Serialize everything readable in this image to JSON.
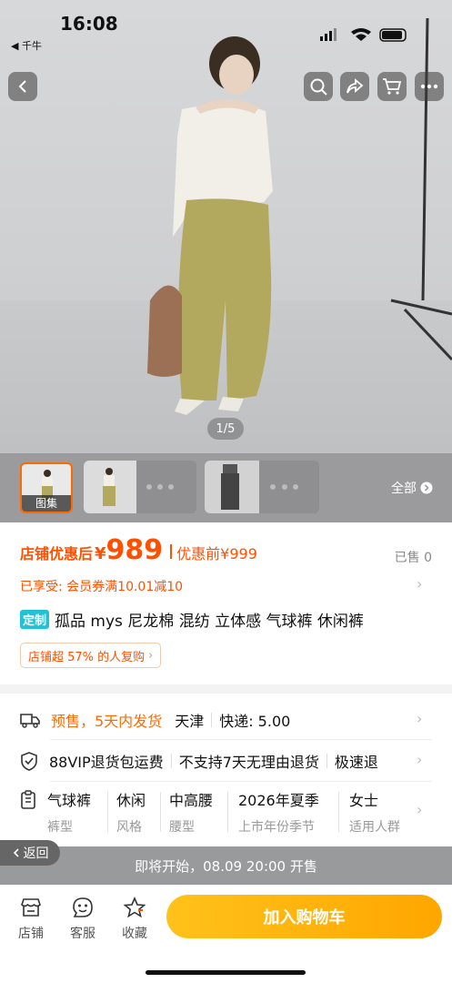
{
  "status_bar": {
    "time": "16:08",
    "back_app": "◀ 千牛"
  },
  "gallery": {
    "counter": "1/5",
    "thumb_label": "图集",
    "all_label": "全部"
  },
  "price": {
    "label": "店铺优惠后",
    "currency": "¥",
    "value": "989",
    "original": "优惠前¥999",
    "sold": "已售 0"
  },
  "coupon": {
    "text": "已享受: 会员券满10.01减10"
  },
  "product": {
    "tag": "定制",
    "title": "孤品 mys 尼龙棉 混纺 立体感 气球裤 休闲裤"
  },
  "repurchase": {
    "text": "店铺超 57% 的人复购"
  },
  "shipping": {
    "presale": "预售，5天内发货",
    "city": "天津",
    "fee": "快递: 5.00"
  },
  "service": {
    "items": [
      "88VIP退货包运费",
      "不支持7天无理由退货",
      "极速退"
    ]
  },
  "attributes": [
    {
      "value": "气球裤",
      "key": "裤型"
    },
    {
      "value": "休闲",
      "key": "风格"
    },
    {
      "value": "中高腰",
      "key": "腰型"
    },
    {
      "value": "2026年夏季",
      "key": "上市年份季节"
    },
    {
      "value": "女士",
      "key": "适用人群"
    }
  ],
  "presale_bar": {
    "text": "即将开始，08.09 20:00 开售"
  },
  "return_button": {
    "label": "返回"
  },
  "bottom_bar": {
    "shop": "店铺",
    "service": "客服",
    "favorite": "收藏",
    "add_to_cart": "加入购物车"
  },
  "colors": {
    "accent": "#ff5000",
    "cta": "#ffa600",
    "tag": "#22c2d6"
  }
}
